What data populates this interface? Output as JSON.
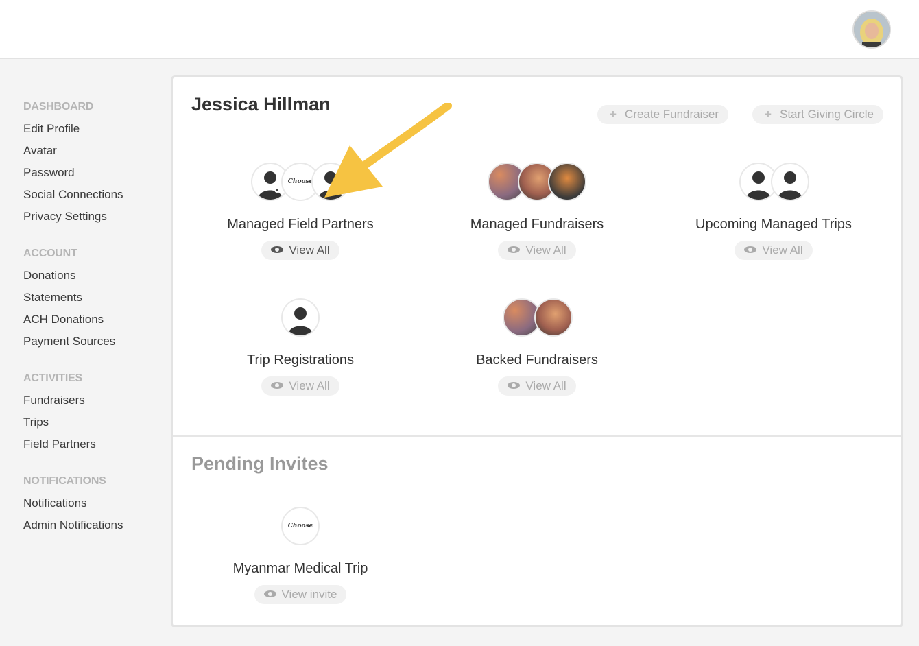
{
  "sidebar": {
    "sections": [
      {
        "heading": "DASHBOARD",
        "items": [
          "Edit Profile",
          "Avatar",
          "Password",
          "Social Connections",
          "Privacy Settings"
        ]
      },
      {
        "heading": "ACCOUNT",
        "items": [
          "Donations",
          "Statements",
          "ACH Donations",
          "Payment Sources"
        ]
      },
      {
        "heading": "ACTIVITIES",
        "items": [
          "Fundraisers",
          "Trips",
          "Field Partners"
        ]
      },
      {
        "heading": "NOTIFICATIONS",
        "items": [
          "Notifications",
          "Admin Notifications"
        ]
      }
    ]
  },
  "main": {
    "title": "Jessica Hillman",
    "create_fundraiser": "Create Fundraiser",
    "start_giving_circle": "Start Giving Circle",
    "tiles": [
      {
        "label": "Managed Field Partners",
        "button": "View All"
      },
      {
        "label": "Managed Fundraisers",
        "button": "View All"
      },
      {
        "label": "Upcoming Managed Trips",
        "button": "View All"
      },
      {
        "label": "Trip Registrations",
        "button": "View All"
      },
      {
        "label": "Backed Fundraisers",
        "button": "View All"
      }
    ],
    "logo_text": "Choose Hope"
  },
  "pending": {
    "title": "Pending Invites",
    "invite": {
      "label": "Myanmar Medical Trip",
      "button": "View invite"
    }
  },
  "colors": {
    "arrow": "#f6c342",
    "muted": "#aaaaaa"
  }
}
